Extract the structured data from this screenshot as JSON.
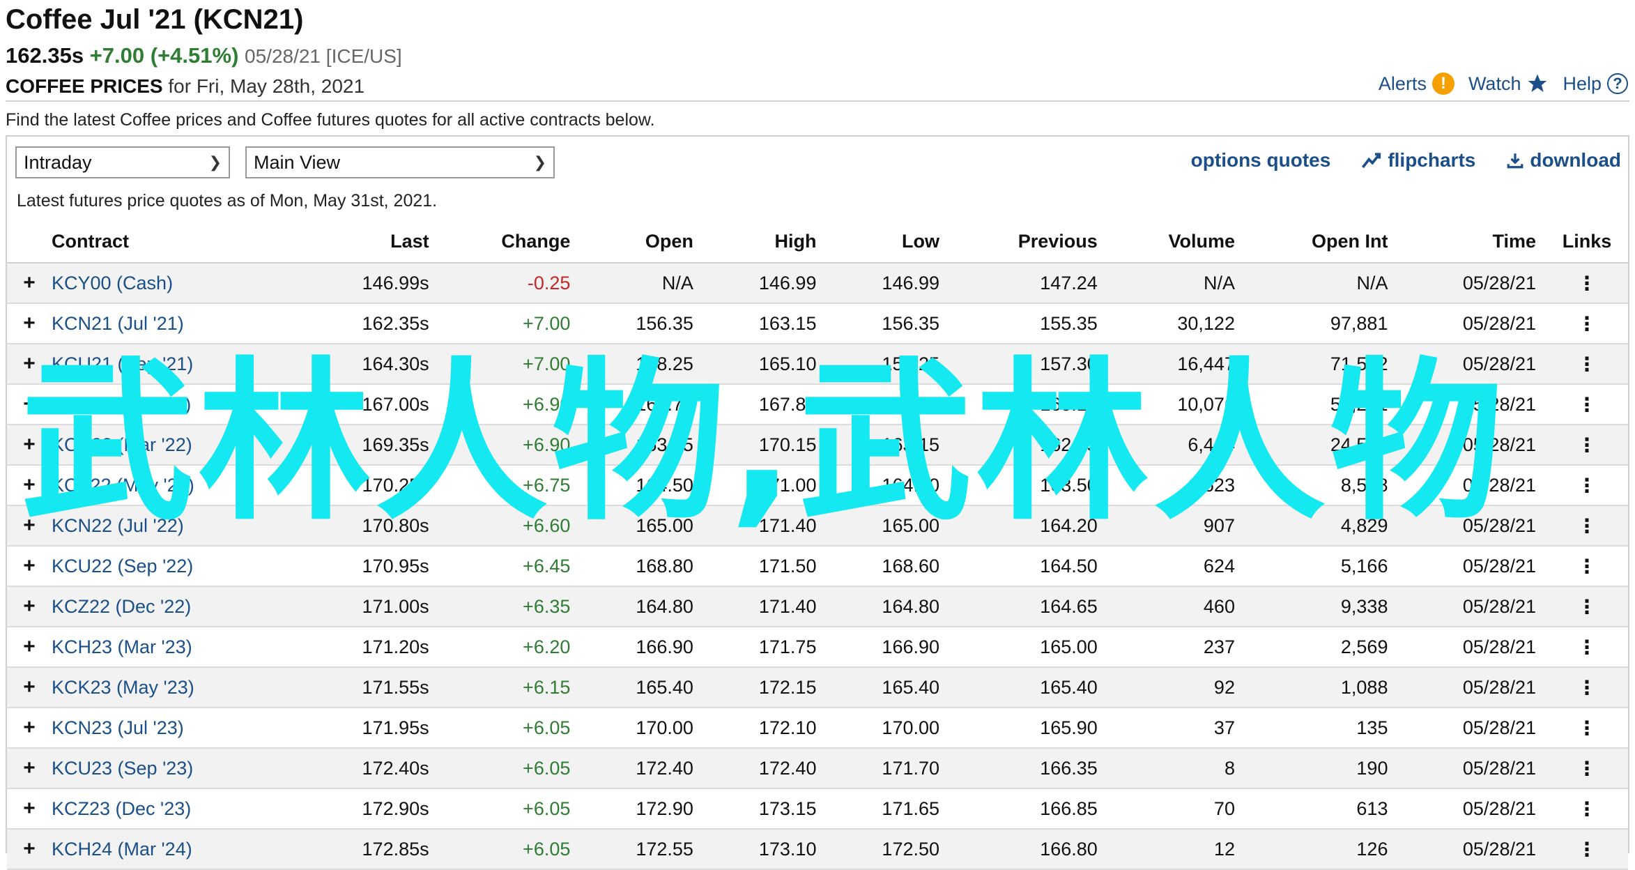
{
  "header": {
    "title": "Coffee Jul '21 (KCN21)",
    "last": "162.35s",
    "change": "+7.00 (+4.51%)",
    "meta": "05/28/21 [ICE/US]",
    "prices_label": "COFFEE PRICES",
    "prices_date": "for Fri, May 28th, 2021",
    "alerts": "Alerts",
    "watch": "Watch",
    "help": "Help"
  },
  "description": "Find the latest Coffee prices and Coffee futures quotes for all active contracts below.",
  "controls": {
    "period": "Intraday",
    "view": "Main View",
    "options_quotes": "options quotes",
    "flipcharts": "flipcharts",
    "download": "download"
  },
  "asof": "Latest futures price quotes as of Mon, May 31st, 2021.",
  "overlay_text": "武林人物,武林人物",
  "columns": [
    "Contract",
    "Last",
    "Change",
    "Open",
    "High",
    "Low",
    "Previous",
    "Volume",
    "Open Int",
    "Time",
    "Links"
  ],
  "rows": [
    {
      "contract": "KCY00 (Cash)",
      "last": "146.99s",
      "change": "-0.25",
      "open": "N/A",
      "high": "146.99",
      "low": "146.99",
      "previous": "147.24",
      "volume": "N/A",
      "open_int": "N/A",
      "time": "05/28/21"
    },
    {
      "contract": "KCN21 (Jul '21)",
      "last": "162.35s",
      "change": "+7.00",
      "open": "156.35",
      "high": "163.15",
      "low": "156.35",
      "previous": "155.35",
      "volume": "30,122",
      "open_int": "97,881",
      "time": "05/28/21"
    },
    {
      "contract": "KCU21 (Sep '21)",
      "last": "164.30s",
      "change": "+7.00",
      "open": "158.25",
      "high": "165.10",
      "low": "158.25",
      "previous": "157.30",
      "volume": "16,447",
      "open_int": "71,562",
      "time": "05/28/21"
    },
    {
      "contract": "KCZ21 (Dec '21)",
      "last": "167.00s",
      "change": "+6.90",
      "open": "161.70",
      "high": "167.85",
      "low": "160.75",
      "previous": "160.10",
      "volume": "10,076",
      "open_int": "51,241",
      "time": "05/28/21"
    },
    {
      "contract": "KCH22 (Mar '22)",
      "last": "169.35s",
      "change": "+6.90",
      "open": "163.75",
      "high": "170.15",
      "low": "163.15",
      "previous": "162.45",
      "volume": "6,414",
      "open_int": "24,506",
      "time": "05/28/21"
    },
    {
      "contract": "KCK22 (May '22)",
      "last": "170.25s",
      "change": "+6.75",
      "open": "164.50",
      "high": "171.00",
      "low": "164.50",
      "previous": "163.50",
      "volume": "1,623",
      "open_int": "8,528",
      "time": "05/28/21"
    },
    {
      "contract": "KCN22 (Jul '22)",
      "last": "170.80s",
      "change": "+6.60",
      "open": "165.00",
      "high": "171.40",
      "low": "165.00",
      "previous": "164.20",
      "volume": "907",
      "open_int": "4,829",
      "time": "05/28/21"
    },
    {
      "contract": "KCU22 (Sep '22)",
      "last": "170.95s",
      "change": "+6.45",
      "open": "168.80",
      "high": "171.50",
      "low": "168.60",
      "previous": "164.50",
      "volume": "624",
      "open_int": "5,166",
      "time": "05/28/21"
    },
    {
      "contract": "KCZ22 (Dec '22)",
      "last": "171.00s",
      "change": "+6.35",
      "open": "164.80",
      "high": "171.40",
      "low": "164.80",
      "previous": "164.65",
      "volume": "460",
      "open_int": "9,338",
      "time": "05/28/21"
    },
    {
      "contract": "KCH23 (Mar '23)",
      "last": "171.20s",
      "change": "+6.20",
      "open": "166.90",
      "high": "171.75",
      "low": "166.90",
      "previous": "165.00",
      "volume": "237",
      "open_int": "2,569",
      "time": "05/28/21"
    },
    {
      "contract": "KCK23 (May '23)",
      "last": "171.55s",
      "change": "+6.15",
      "open": "165.40",
      "high": "172.15",
      "low": "165.40",
      "previous": "165.40",
      "volume": "92",
      "open_int": "1,088",
      "time": "05/28/21"
    },
    {
      "contract": "KCN23 (Jul '23)",
      "last": "171.95s",
      "change": "+6.05",
      "open": "170.00",
      "high": "172.10",
      "low": "170.00",
      "previous": "165.90",
      "volume": "37",
      "open_int": "135",
      "time": "05/28/21"
    },
    {
      "contract": "KCU23 (Sep '23)",
      "last": "172.40s",
      "change": "+6.05",
      "open": "172.40",
      "high": "172.40",
      "low": "171.70",
      "previous": "166.35",
      "volume": "8",
      "open_int": "190",
      "time": "05/28/21"
    },
    {
      "contract": "KCZ23 (Dec '23)",
      "last": "172.90s",
      "change": "+6.05",
      "open": "172.90",
      "high": "173.15",
      "low": "171.65",
      "previous": "166.85",
      "volume": "70",
      "open_int": "613",
      "time": "05/28/21"
    },
    {
      "contract": "KCH24 (Mar '24)",
      "last": "172.85s",
      "change": "+6.05",
      "open": "172.55",
      "high": "173.10",
      "low": "172.50",
      "previous": "166.80",
      "volume": "12",
      "open_int": "126",
      "time": "05/28/21"
    }
  ]
}
